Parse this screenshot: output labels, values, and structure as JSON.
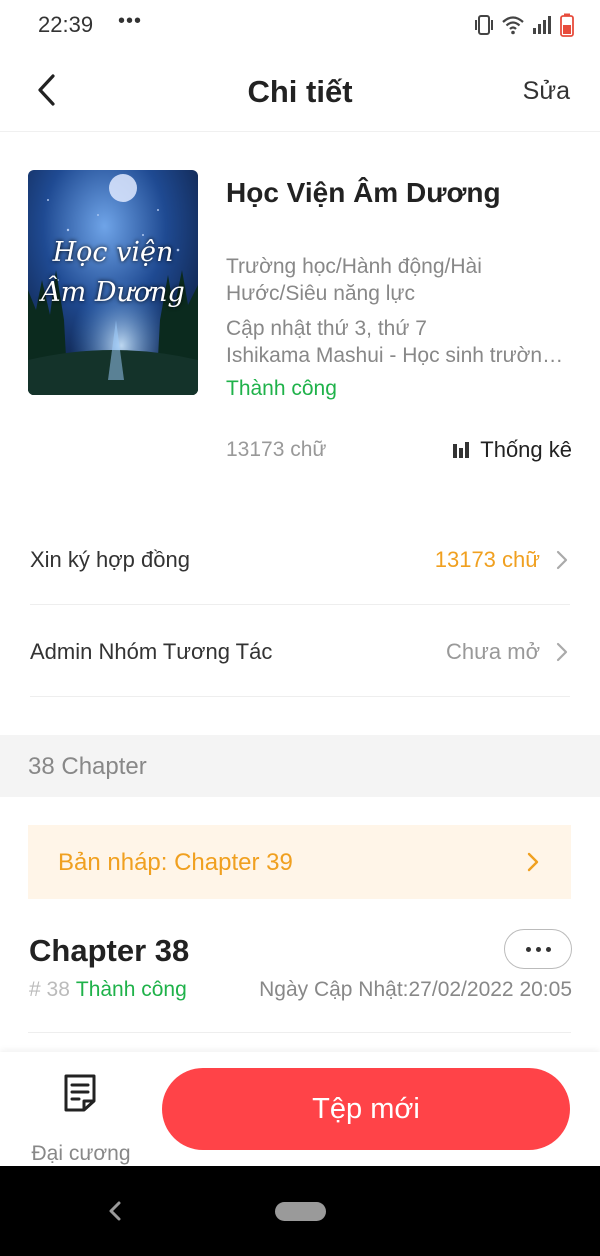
{
  "status_bar": {
    "time": "22:39",
    "dots": "•••",
    "icons": [
      "vibrate-icon",
      "wifi-icon",
      "signal-icon",
      "battery-icon"
    ]
  },
  "header": {
    "title": "Chi tiết",
    "edit_label": "Sửa",
    "back_icon": "chevron-left-icon"
  },
  "book": {
    "cover_title": "Học viện Âm Dương",
    "title": "Học Viện Âm Dương",
    "genres": "Trường học/Hành động/Hài Hước/Siêu năng lực",
    "schedule": "Cập nhật thứ 3, thứ 7",
    "description": "Ishikama Mashui - Học sinh trường trung học Âm Dương",
    "status": "Thành công",
    "word_count": "13173 chữ",
    "stats_label": "Thống kê"
  },
  "menu": {
    "contract": {
      "label": "Xin ký hợp đồng",
      "value": "13173 chữ"
    },
    "admin_group": {
      "label": "Admin Nhóm Tương Tác",
      "value": "Chưa mở"
    }
  },
  "chapters": {
    "section_title": "38 Chapter",
    "draft_label": "Bản nháp: Chapter 39",
    "latest": {
      "title": "Chapter 38",
      "number": "# 38",
      "status": "Thành công",
      "updated": "Ngày Cập Nhật:27/02/2022 20:05"
    }
  },
  "bottom_bar": {
    "outline_label": "Đại cương",
    "new_file_label": "Tệp mới"
  },
  "colors": {
    "accent_red": "#ff4348",
    "success_green": "#1fb24a",
    "warning_orange": "#f0a020",
    "draft_background": "#fff5e8"
  }
}
